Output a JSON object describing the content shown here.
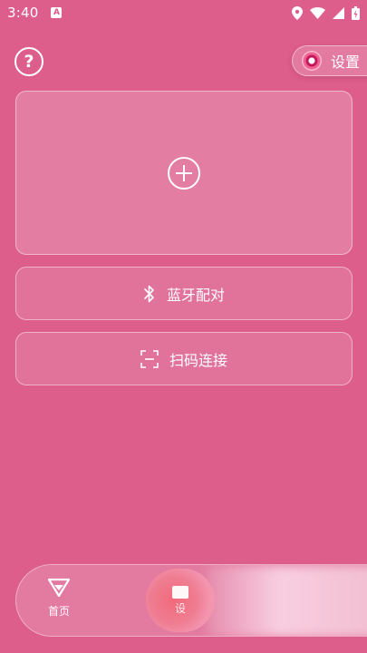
{
  "status_bar": {
    "time": "3:40",
    "notification_badge": "A",
    "icons": [
      "location-icon",
      "wifi-icon",
      "signal-icon",
      "battery-icon"
    ]
  },
  "header": {
    "help_label": "?",
    "settings_label": "设置"
  },
  "main": {
    "add_card_icon": "plus-circle-icon",
    "bluetooth_label": "蓝牙配对",
    "scan_label": "扫码连接"
  },
  "bottom_nav": {
    "home_label": "首页",
    "device_label": "设"
  },
  "colors": {
    "background": "#dd5d8b",
    "accent": "#c2185b",
    "nav_active": "#f26a7a"
  }
}
